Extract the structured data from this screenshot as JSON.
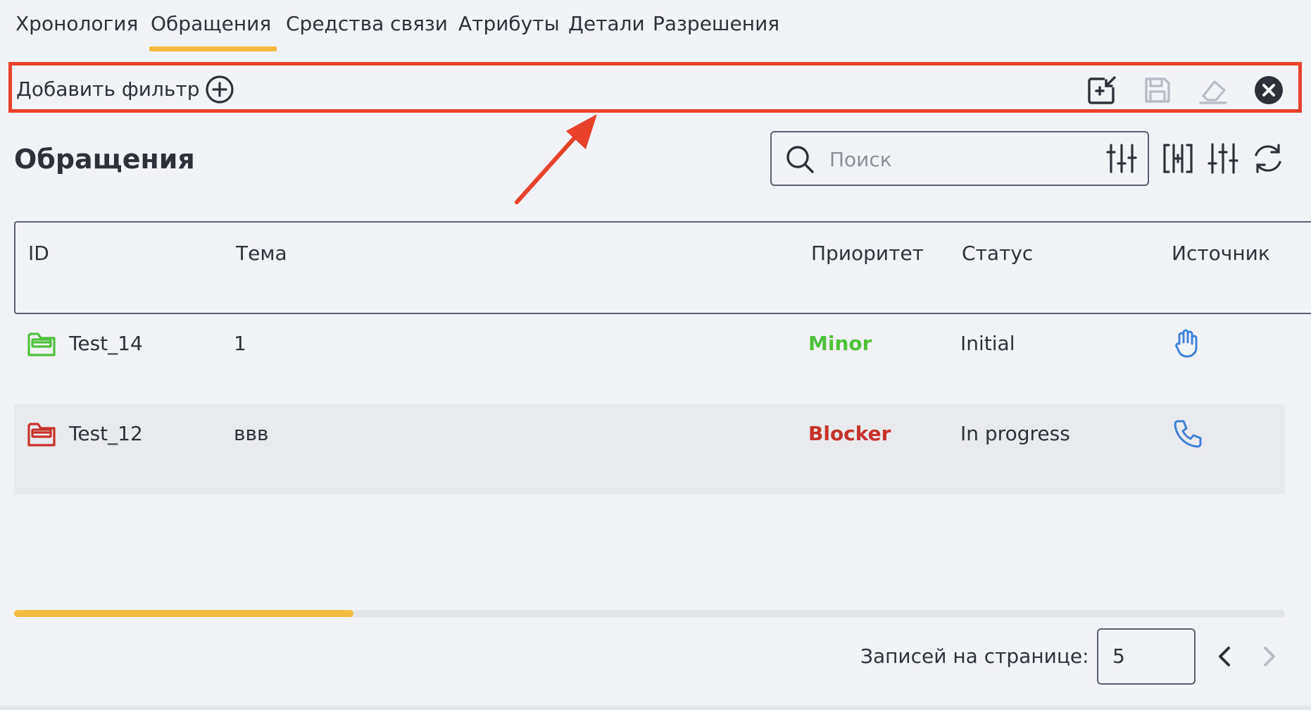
{
  "tabs": [
    {
      "label": "Хронология"
    },
    {
      "label": "Обращения",
      "active": true
    },
    {
      "label": "Средства связи"
    },
    {
      "label": "Атрибуты"
    },
    {
      "label": "Детали"
    },
    {
      "label": "Разрешения"
    }
  ],
  "filter_bar": {
    "add_filter_label": "Добавить фильтр",
    "icons": [
      "add-to-list-icon",
      "save-icon",
      "eraser-icon",
      "close-circle-icon"
    ]
  },
  "page": {
    "title": "Обращения"
  },
  "search": {
    "placeholder": "Поиск",
    "value": ""
  },
  "table": {
    "columns": [
      "ID",
      "Тема",
      "Приоритет",
      "Статус",
      "Источник"
    ],
    "rows": [
      {
        "id": "Test_14",
        "subject": "1",
        "priority": "Minor",
        "priority_color": "#4fc13b",
        "status": "Initial",
        "source_icon": "hand-icon",
        "folder_color": "#4fc13b"
      },
      {
        "id": "Test_12",
        "subject": "ввв",
        "priority": "Blocker",
        "priority_color": "#c8322a",
        "status": "In progress",
        "source_icon": "phone-icon",
        "folder_color": "#c8322a"
      }
    ]
  },
  "scroll_progress": 0.267,
  "pagination": {
    "rows_per_page_label": "Записей на странице:",
    "rows_per_page": "5"
  },
  "colors": {
    "accent": "#f2bb3f",
    "highlight": "#e8412c",
    "icon_blue": "#3f7fd8"
  }
}
